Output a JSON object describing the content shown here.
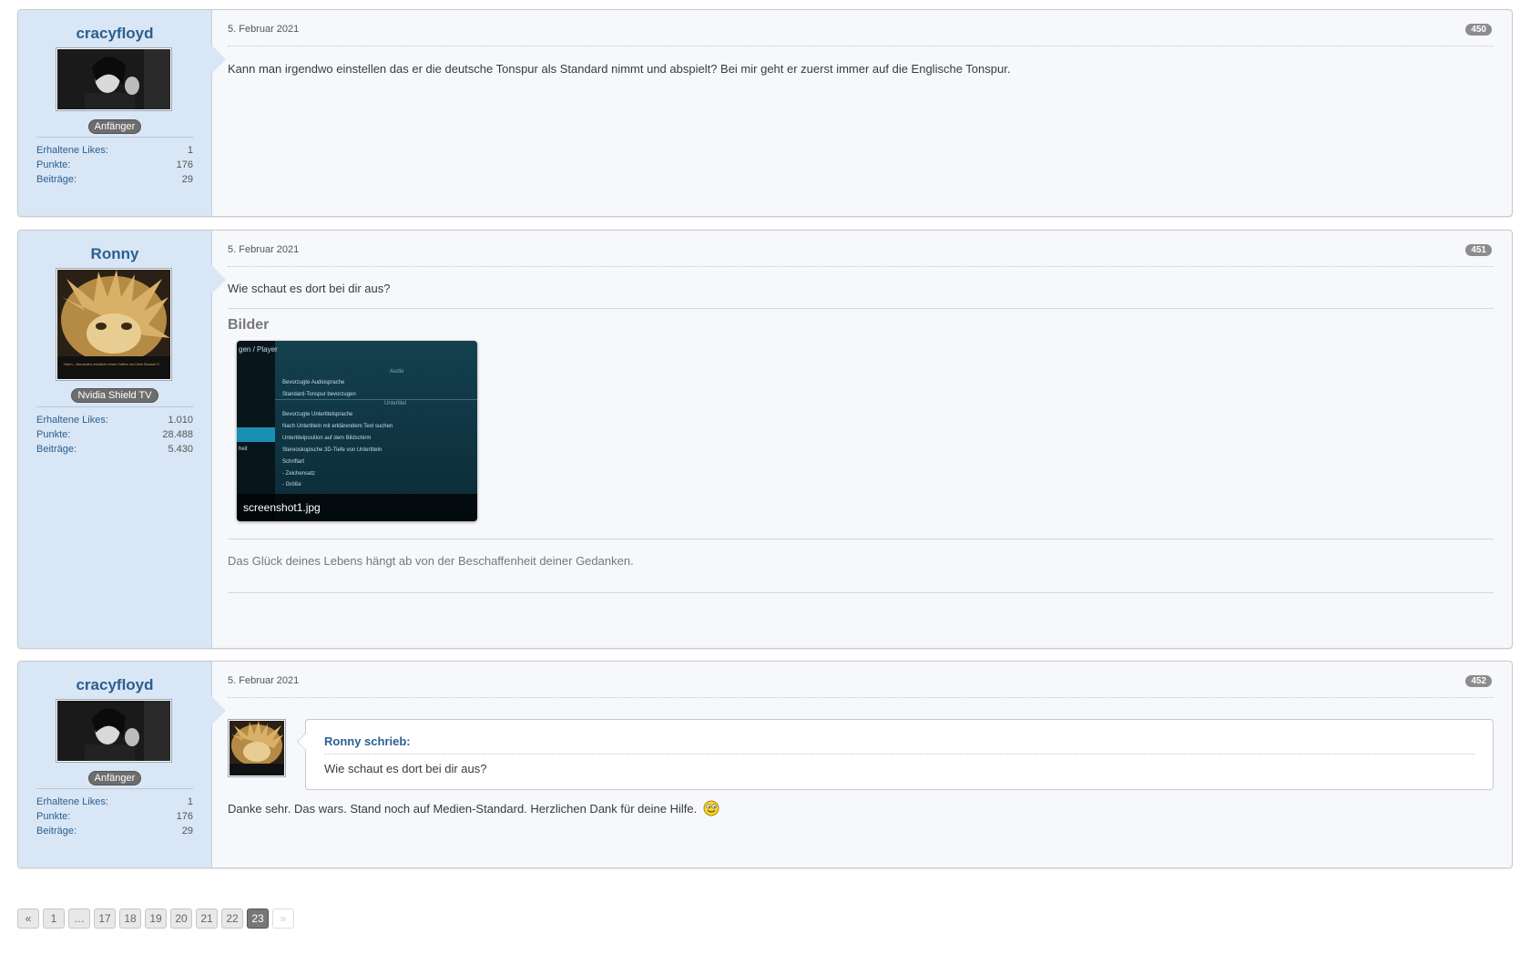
{
  "posts": [
    {
      "author": "cracyfloyd",
      "rank": "Anfänger",
      "stats": [
        {
          "label": "Erhaltene Likes:",
          "value": "1"
        },
        {
          "label": "Punkte:",
          "value": "176"
        },
        {
          "label": "Beiträge:",
          "value": "29"
        }
      ],
      "date": "5. Februar 2021",
      "number": "450",
      "text": "Kann man irgendwo einstellen das er die deutsche Tonspur als Standard nimmt und abspielt? Bei mir geht er zuerst immer auf die Englische Tonspur."
    },
    {
      "author": "Ronny",
      "rank": "Nvidia Shield TV",
      "stats": [
        {
          "label": "Erhaltene Likes:",
          "value": "1.010"
        },
        {
          "label": "Punkte:",
          "value": "28.488"
        },
        {
          "label": "Beiträge:",
          "value": "5.430"
        }
      ],
      "date": "5. Februar 2021",
      "number": "451",
      "text": "Wie schaut es dort bei dir aus?",
      "images_title": "Bilder",
      "attachment": {
        "filename": "screenshot1.jpg",
        "lines": [
          "gen / Player",
          "Audio",
          "Bevorzugte Audiosprache",
          "Standard-Tonspur bevorzugen",
          "Untertitel",
          "Bevorzugte Untertitelsprache",
          "Nach Untertiteln mit erklärendem Text suchen",
          "Untertitelposition auf dem Bildschirm",
          "Stereoskopische 3D-Tiefe von Untertiteln",
          "Schriftart",
          "- Zeichensatz",
          "- Größe",
          "heit"
        ]
      },
      "avatar_caption": "Hmm...Jemandes ernstlich einen Kaffee und kein Bowser?!",
      "signature": "Das Glück deines Lebens hängt ab von der Beschaffenheit deiner Gedanken."
    },
    {
      "author": "cracyfloyd",
      "rank": "Anfänger",
      "stats": [
        {
          "label": "Erhaltene Likes:",
          "value": "1"
        },
        {
          "label": "Punkte:",
          "value": "176"
        },
        {
          "label": "Beiträge:",
          "value": "29"
        }
      ],
      "date": "5. Februar 2021",
      "number": "452",
      "quote": {
        "author": "Ronny schrieb:",
        "text": "Wie schaut es dort bei dir aus?"
      },
      "text": "Danke sehr. Das wars. Stand noch auf Medien-Standard. Herzlichen Dank für deine Hilfe."
    }
  ],
  "pagination": {
    "first": "«",
    "pages": [
      "1",
      "…",
      "17",
      "18",
      "19",
      "20",
      "21",
      "22",
      "23"
    ],
    "current": "23",
    "next": "»"
  }
}
